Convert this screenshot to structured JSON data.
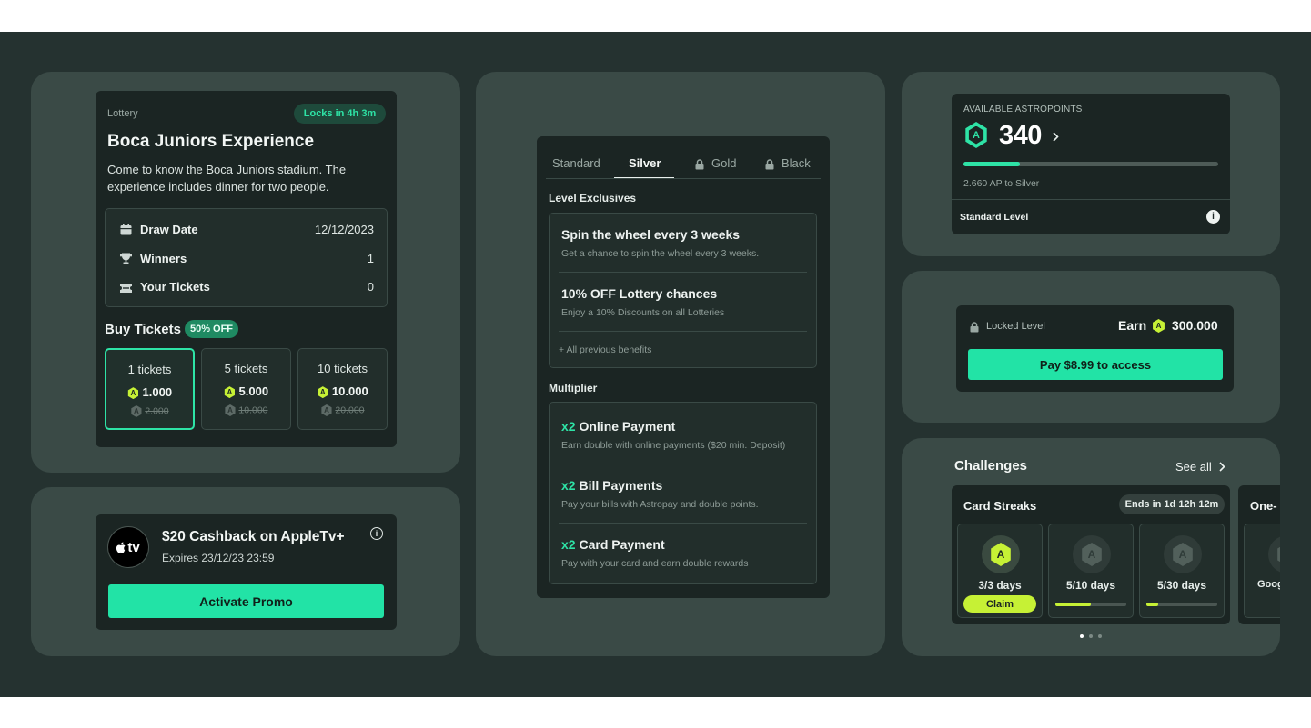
{
  "lottery": {
    "category": "Lottery",
    "lock_badge": "Locks in 4h 3m",
    "title": "Boca Juniors Experience",
    "description": "Come to know the Boca Juniors stadium. The experience includes dinner for two people.",
    "details": [
      {
        "label": "Draw Date",
        "value": "12/12/2023",
        "icon": "calendar-icon"
      },
      {
        "label": "Winners",
        "value": "1",
        "icon": "trophy-icon"
      },
      {
        "label": "Your Tickets",
        "value": "0",
        "icon": "ticket-icon"
      }
    ],
    "buy_title": "Buy Tickets",
    "discount_badge": "50% OFF",
    "tickets": [
      {
        "label": "1 tickets",
        "price": "1.000",
        "old_price": "2.000"
      },
      {
        "label": "5 tickets",
        "price": "5.000",
        "old_price": "10.000"
      },
      {
        "label": "10 tickets",
        "price": "10.000",
        "old_price": "20.000"
      }
    ]
  },
  "promo": {
    "logo_text": "tv",
    "title": "$20 Cashback on AppleTv+",
    "expires": "Expires 23/12/23 23:59",
    "button": "Activate Promo"
  },
  "levels": {
    "tabs": [
      "Standard",
      "Silver",
      "Gold",
      "Black"
    ],
    "active_tab": "Silver",
    "exclusives_title": "Level Exclusives",
    "exclusives": [
      {
        "title": "Spin the wheel every 3 weeks",
        "subtitle": "Get a chance to spin the wheel every 3 weeks."
      },
      {
        "title": "10% OFF Lottery chances",
        "subtitle": "Enjoy a 10% Discounts on all Lotteries"
      }
    ],
    "previous_benefits": "+ All previous benefits",
    "multiplier_title": "Multiplier",
    "multipliers": [
      {
        "factor": "x2",
        "title": "Online Payment",
        "subtitle": "Earn double with online payments ($20 min. Deposit)"
      },
      {
        "factor": "x2",
        "title": "Bill Payments",
        "subtitle": "Pay your bills with Astropay and double points."
      },
      {
        "factor": "x2",
        "title": "Card Payment",
        "subtitle": "Pay with your card and earn double rewards"
      }
    ]
  },
  "points": {
    "label": "AVAILABLE ASTROPOINTS",
    "value": "340",
    "progress": 0.22,
    "to_next": "2.660 AP to Silver",
    "level": "Standard Level",
    "badge_letter": "A"
  },
  "locked": {
    "label": "Locked Level",
    "earn_label": "Earn",
    "earn_value": "300.000",
    "button": "Pay $8.99 to access"
  },
  "challenges": {
    "title": "Challenges",
    "see_all": "See all",
    "card_title": "Card Streaks",
    "ends_badge": "Ends in 1d 12h 12m",
    "streaks": [
      {
        "days": "3/3 days",
        "progress": 1.0,
        "claim": "Claim"
      },
      {
        "days": "5/10 days",
        "progress": 0.5
      },
      {
        "days": "5/30 days",
        "progress": 0.17
      }
    ],
    "next_card_title": "One-",
    "next_card_item": "Goog",
    "colors": {
      "accent": "#2ee3a6",
      "lime": "#c6f135"
    }
  }
}
